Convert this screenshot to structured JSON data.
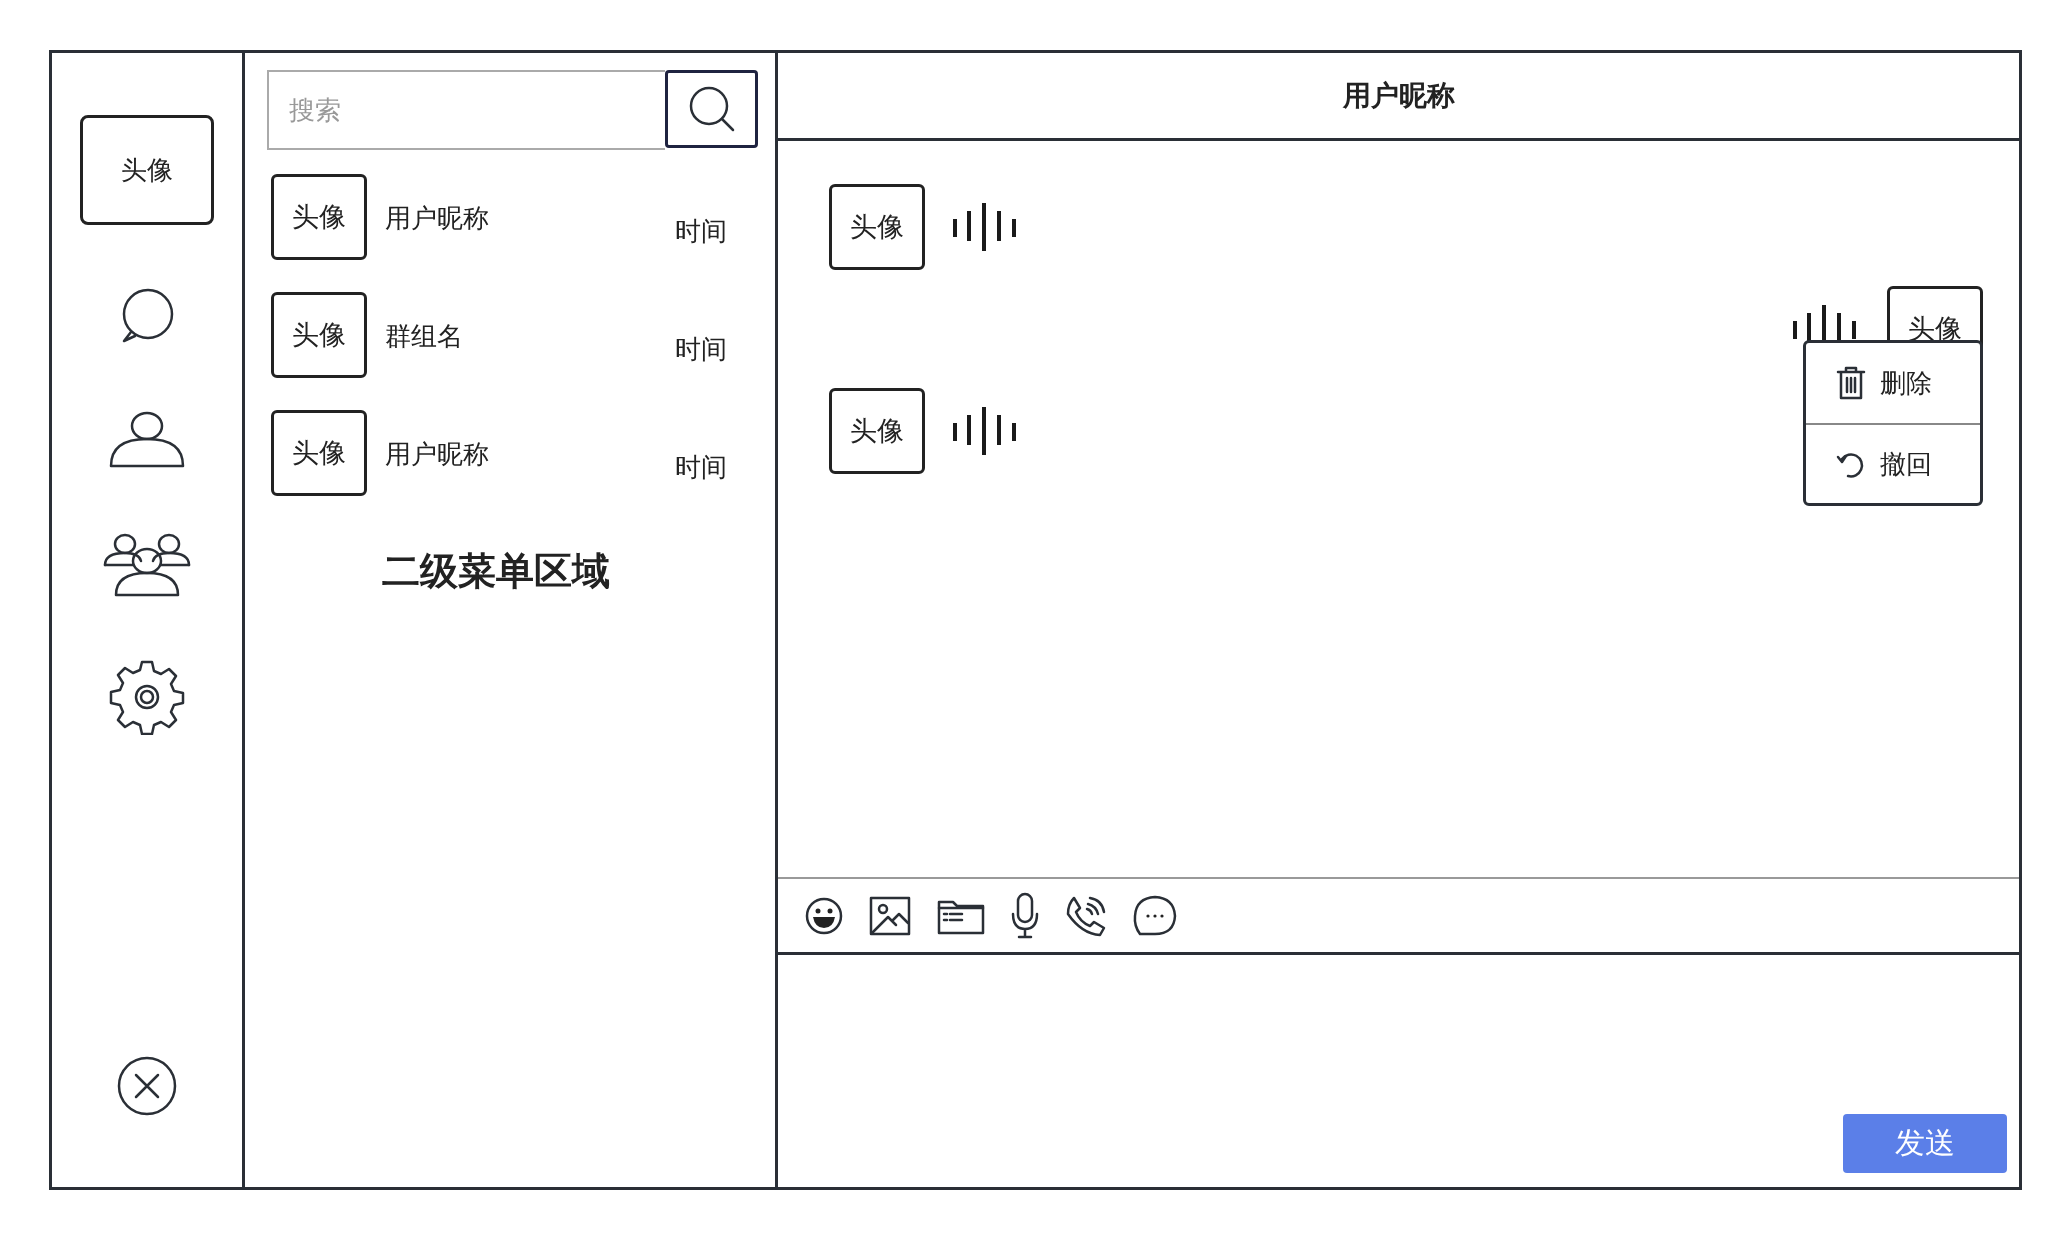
{
  "sidebar": {
    "avatar": "头像",
    "nav_icons": [
      {
        "kind": "chat"
      },
      {
        "kind": "contact"
      },
      {
        "kind": "group"
      },
      {
        "kind": "settings"
      }
    ],
    "bottom_icon": {
      "kind": "close"
    }
  },
  "secondary_menu": {
    "search": {
      "placeholder": "搜索"
    },
    "conversations": [
      {
        "avatar": "头像",
        "name": "用户昵称",
        "time": "时间"
      },
      {
        "avatar": "头像",
        "name": "群组名",
        "time": "时间"
      },
      {
        "avatar": "头像",
        "name": "用户昵称",
        "time": "时间"
      }
    ],
    "area_label": "二级菜单区域"
  },
  "chat": {
    "title": "用户昵称",
    "messages": [
      {
        "outgoing": false,
        "avatar": "头像",
        "kind": "voice"
      },
      {
        "outgoing": true,
        "avatar": "头像",
        "kind": "voice"
      },
      {
        "outgoing": false,
        "avatar": "头像",
        "kind": "voice"
      }
    ],
    "context_menu": {
      "items": [
        {
          "kind": "trash",
          "label": "删除"
        },
        {
          "kind": "undo",
          "label": "撤回"
        }
      ]
    },
    "toolbar": [
      {
        "kind": "emoji"
      },
      {
        "kind": "image"
      },
      {
        "kind": "folder"
      },
      {
        "kind": "mic"
      },
      {
        "kind": "phone"
      },
      {
        "kind": "more"
      }
    ],
    "send_button": "发送"
  }
}
